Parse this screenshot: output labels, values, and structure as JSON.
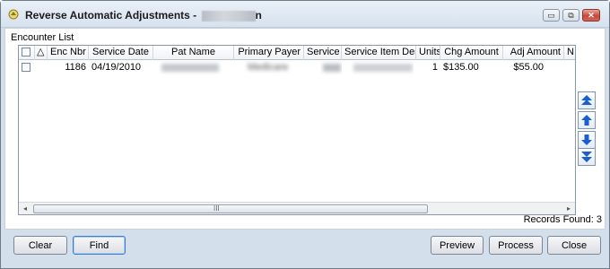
{
  "window": {
    "title": "Reverse Automatic Adjustments - ",
    "title_suffix": "n",
    "controls": {
      "minimize": "▭",
      "restore": "⧉",
      "close": "✕"
    }
  },
  "encounter_list": {
    "label": "Encounter List",
    "columns": [
      "",
      "Enc Nbr",
      "Service Date",
      "Pat Name",
      "Primary Payer",
      "Service",
      "Service Item Desc",
      "Units",
      "Chg Amount",
      "Adj Amount",
      "N"
    ],
    "sort_indicator": "△",
    "rows": [
      {
        "enc_nbr": "1186",
        "service_date": "04/19/2010",
        "pat_name": "",
        "primary_payer": "Medicare",
        "service": "",
        "service_item_desc": "",
        "units": "1",
        "chg_amount": "$135.00",
        "adj_amount": "$55.00"
      }
    ],
    "scroll_grip": "III"
  },
  "records_found": "Records Found: 3",
  "buttons": {
    "clear": "Clear",
    "find": "Find",
    "preview": "Preview",
    "process": "Process",
    "close": "Close"
  }
}
